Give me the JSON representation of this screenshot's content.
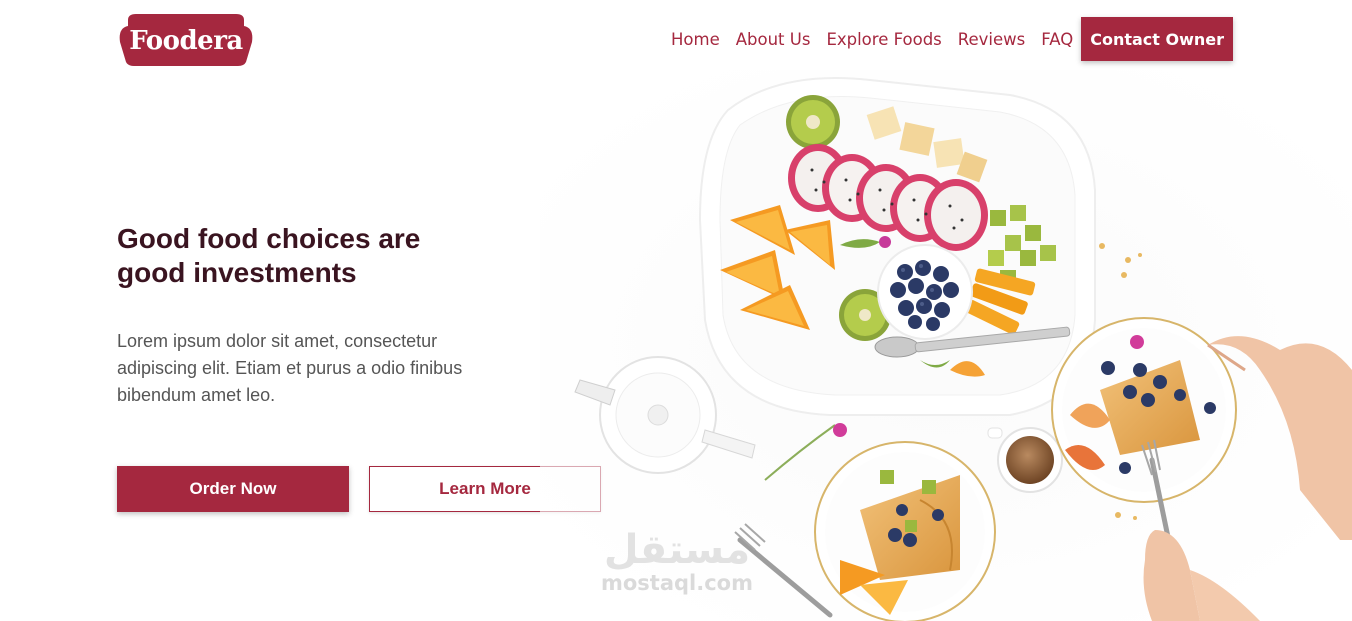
{
  "brand": {
    "name": "Foodera",
    "color": "#a5283f"
  },
  "nav": {
    "items": [
      "Home",
      "About Us",
      "Explore Foods",
      "Reviews",
      "FAQ"
    ],
    "cta": "Contact Owner"
  },
  "hero": {
    "title": "Good food choices are good investments",
    "body": "Lorem ipsum dolor sit amet, consectetur adipiscing elit. Etiam et purus a odio finibus bibendum amet leo.",
    "primary_button": "Order Now",
    "secondary_button": "Learn More"
  },
  "watermark": {
    "arabic": "مستقل",
    "latin": "mostaql.com"
  },
  "colors": {
    "accent": "#a5283f",
    "heading": "#3a1420",
    "body_text": "#555555"
  }
}
